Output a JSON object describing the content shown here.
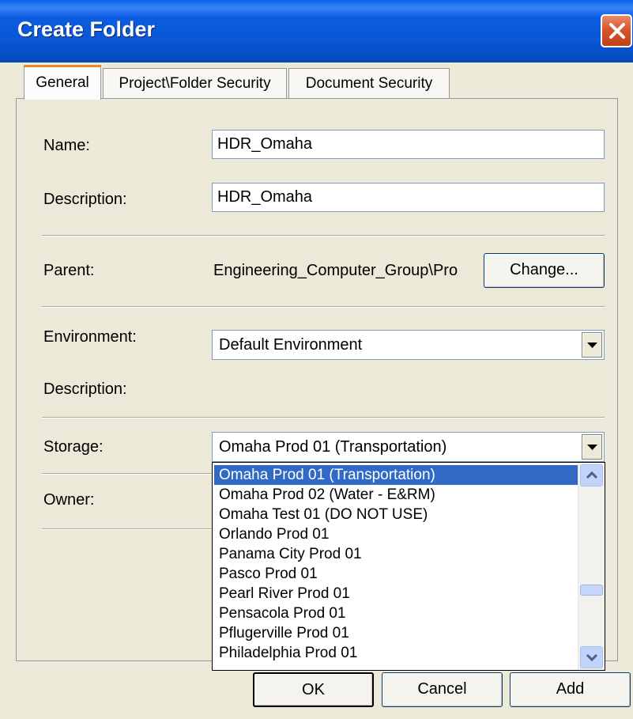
{
  "window": {
    "title": "Create Folder"
  },
  "tabs": [
    {
      "label": "General"
    },
    {
      "label": "Project\\Folder Security"
    },
    {
      "label": "Document Security"
    }
  ],
  "fields": {
    "name_label": "Name:",
    "name_value": "HDR_Omaha",
    "description_label": "Description:",
    "description_value": "HDR_Omaha",
    "parent_label": "Parent:",
    "parent_value": "Engineering_Computer_Group\\Pro",
    "change_label": "Change...",
    "environment_label": "Environment:",
    "environment_value": "Default Environment",
    "env_description_label": "Description:",
    "storage_label": "Storage:",
    "storage_value": "Omaha Prod 01 (Transportation)",
    "owner_label": "Owner:"
  },
  "storage_options": [
    "Omaha Prod 01 (Transportation)",
    "Omaha Prod 02 (Water - E&RM)",
    "Omaha Test 01 (DO NOT USE)",
    "Orlando Prod 01",
    "Panama City Prod 01",
    "Pasco Prod 01",
    "Pearl River Prod 01",
    "Pensacola Prod 01",
    "Pflugerville Prod 01",
    "Philadelphia Prod 01"
  ],
  "footer": {
    "ok_label": "OK",
    "cancel_label": "Cancel",
    "add_label": "Add"
  },
  "colors": {
    "titlebar": "#0A58D6",
    "selection": "#316AC5",
    "face": "#ECE9D8",
    "tab_highlight": "#E68B2C"
  }
}
